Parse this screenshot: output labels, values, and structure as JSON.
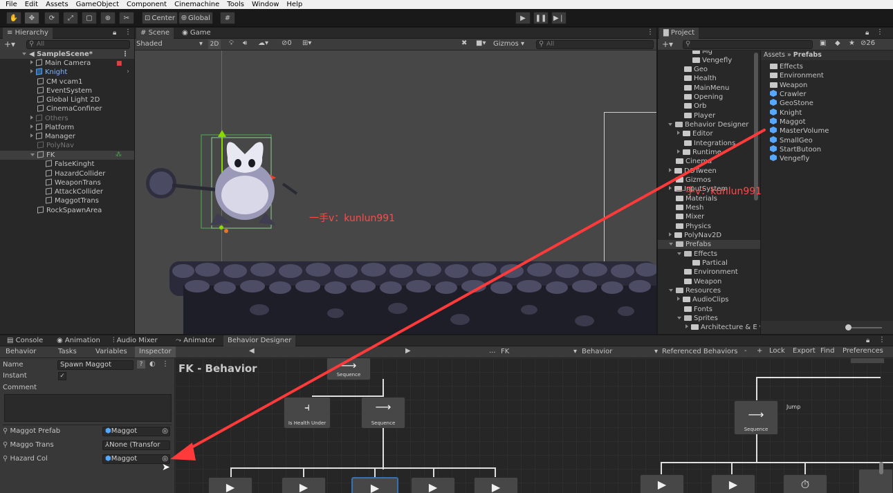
{
  "menu": [
    "File",
    "Edit",
    "Assets",
    "GameObject",
    "Component",
    "Cinemachine",
    "Tools",
    "Window",
    "Help"
  ],
  "toolbar": {
    "center_label": "Center",
    "global_label": "Global"
  },
  "hierarchy": {
    "tab": "Hierarchy",
    "search_placeholder": "All",
    "scene": "SampleScene*",
    "items": [
      "Main Camera",
      "Knight",
      "CM vcam1",
      "EventSystem",
      "Global Light 2D",
      "CinemaConfiner",
      "Others",
      "Platform",
      "Manager",
      "PolyNav",
      "FK",
      "FalseKinght",
      "HazardCollider",
      "WeaponTrans",
      "AttackCollider",
      "MaggotTrans",
      "RockSpawnArea"
    ]
  },
  "scene_view": {
    "tabs": [
      "Scene",
      "Game"
    ],
    "shading": "Shaded",
    "mode_2d": "2D",
    "hidden_count": "0",
    "gizmos": "Gizmos",
    "search_placeholder": "All",
    "watermark": "一手v：kunlun991"
  },
  "project": {
    "tab": "Project",
    "count": "26",
    "breadcrumb_root": "Assets",
    "breadcrumb_sep": "»",
    "breadcrumb_leaf": "Prefabs",
    "tree": [
      "Mg",
      "Vengefly",
      "Geo",
      "Health",
      "MainMenu",
      "Opening",
      "Orb",
      "Player",
      "Behavior Designer",
      "Editor",
      "Integrations",
      "Runtime",
      "Cinema",
      "DOTween",
      "Gizmos",
      "InputSystem",
      "Materials",
      "Mesh",
      "Mixer",
      "Physics",
      "PolyNav2D",
      "Prefabs",
      "Effects",
      "Partical",
      "Environment",
      "Weapon",
      "Resources",
      "AudioClips",
      "Fonts",
      "Sprites",
      "Architecture & E"
    ],
    "assets": [
      "Effects",
      "Environment",
      "Weapon",
      "Crawler",
      "GeoStone",
      "Knight",
      "Maggot",
      "MasterVolume",
      "SmallGeo",
      "StartButoon",
      "Vengefly"
    ]
  },
  "bottom_tabs": [
    "Console",
    "Animation",
    "Audio Mixer",
    "Animator",
    "Behavior Designer"
  ],
  "bd": {
    "left_tabs": [
      "Behavior",
      "Tasks",
      "Variables",
      "Inspector"
    ],
    "name_label": "Name",
    "name_value": "Spawn Maggot",
    "instant_label": "Instant",
    "instant_check": "✓",
    "comment_label": "Comment",
    "vars": [
      {
        "label": "Maggot Prefab",
        "value": "Maggot"
      },
      {
        "label": "Maggo Trans",
        "value": "None (Transfor"
      },
      {
        "label": "Hazard Col",
        "value": "Maggot"
      }
    ],
    "toolbar": {
      "ellipsis": "...",
      "obj": "FK",
      "behavior": "Behavior",
      "ref": "Referenced Behaviors",
      "minus": "-",
      "plus": "+",
      "lock": "Lock",
      "export": "Export",
      "find": "Find",
      "prefs": "Preferences"
    },
    "graph_title": "FK - Behavior",
    "nodes": {
      "seq_top": "Sequence",
      "health": "Is Health Under",
      "seq_mid": "Sequence",
      "seq_right": "Sequence",
      "jump": "Jump"
    }
  },
  "colors": {
    "accent": "#3a72b0",
    "arrow": "#ff3a3a",
    "watermark": "#ff4a4a"
  }
}
